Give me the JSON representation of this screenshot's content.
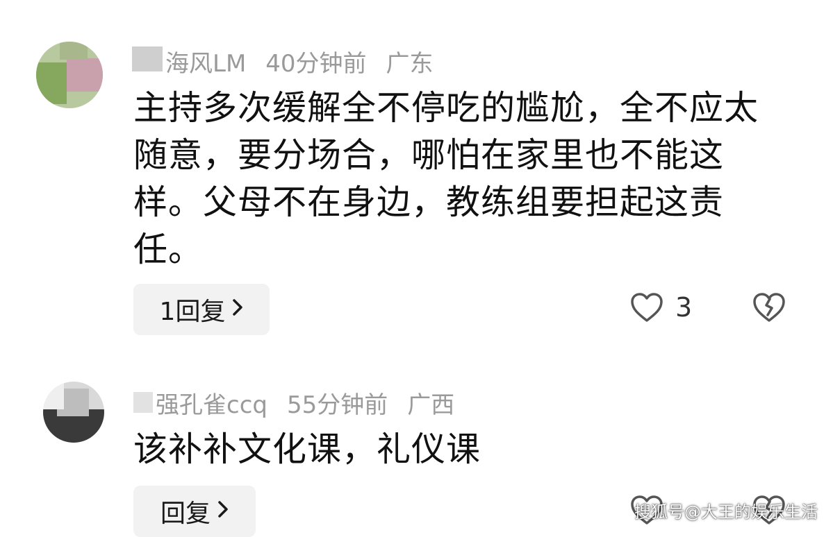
{
  "comments": [
    {
      "username": "海风LM",
      "time": "40分钟前",
      "location": "广东",
      "text": "主持多次缓解全不停吃的尴尬，全不应太随意，要分场合，哪怕在家里也不能这样。父母不在身边，教练组要担起这责任。",
      "reply_label": "1回复",
      "like_count": "3",
      "avatar_colors": [
        "#8fae6a",
        "#c79aa8",
        "#7f9c5a"
      ]
    },
    {
      "username": "强孔雀ccq",
      "time": "55分钟前",
      "location": "广西",
      "text": "该补补文化课，礼仪课",
      "reply_label": "回复",
      "like_count": "",
      "avatar_colors": [
        "#d8d8d8",
        "#2a2a2a",
        "#9a9a9a"
      ]
    }
  ],
  "icons": {
    "like": "heart-icon",
    "dislike": "broken-heart-icon",
    "chevron": "chevron-right-icon"
  },
  "watermark": "搜狐号@大王的娱乐生活"
}
